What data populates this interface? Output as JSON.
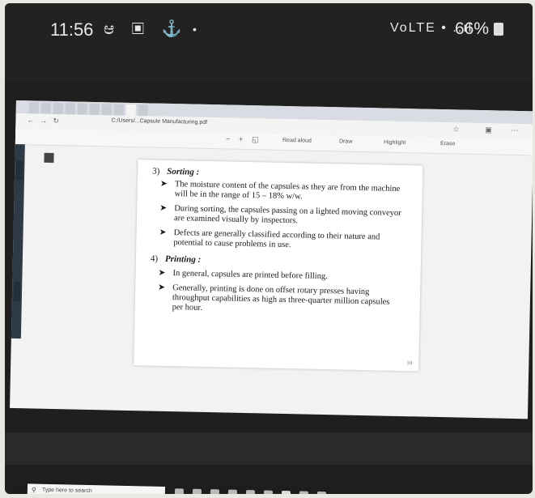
{
  "status_bar": {
    "time": "11:56",
    "left_icons": "ಆ ▣ ⚓",
    "dot": "•",
    "signal": "VoLTE • ..ıl",
    "battery": "66%"
  },
  "browser": {
    "tabs": [
      "",
      "",
      "",
      "",
      "",
      "",
      "",
      "",
      "",
      ""
    ],
    "address": "C:/Users/...Capsule Manufacturing.pdf",
    "pdf_toolbar": [
      "Read aloud",
      "Draw",
      "Highlight",
      "Erase"
    ]
  },
  "pdf": {
    "subtabs": [
      "",
      "",
      ""
    ],
    "sections": [
      {
        "number": "3)",
        "title": "Sorting :",
        "bullets": [
          "The moisture content of the capsules as they are from the machine will be in the range of 15 – 18% w/w.",
          "During sorting, the capsules passing on a lighted moving conveyor are examined visually by inspectors.",
          "Defects are generally classified according to their nature and potential to cause problems in use."
        ]
      },
      {
        "number": "4)",
        "title": "Printing :",
        "bullets": [
          "In general, capsules are printed before filling.",
          "Generally, printing is done on offset rotary presses having throughput capabilities as high as three-quarter million capsules per hour."
        ]
      }
    ],
    "page_number": "10"
  },
  "taskbar": {
    "search_placeholder": "Type here to search"
  }
}
